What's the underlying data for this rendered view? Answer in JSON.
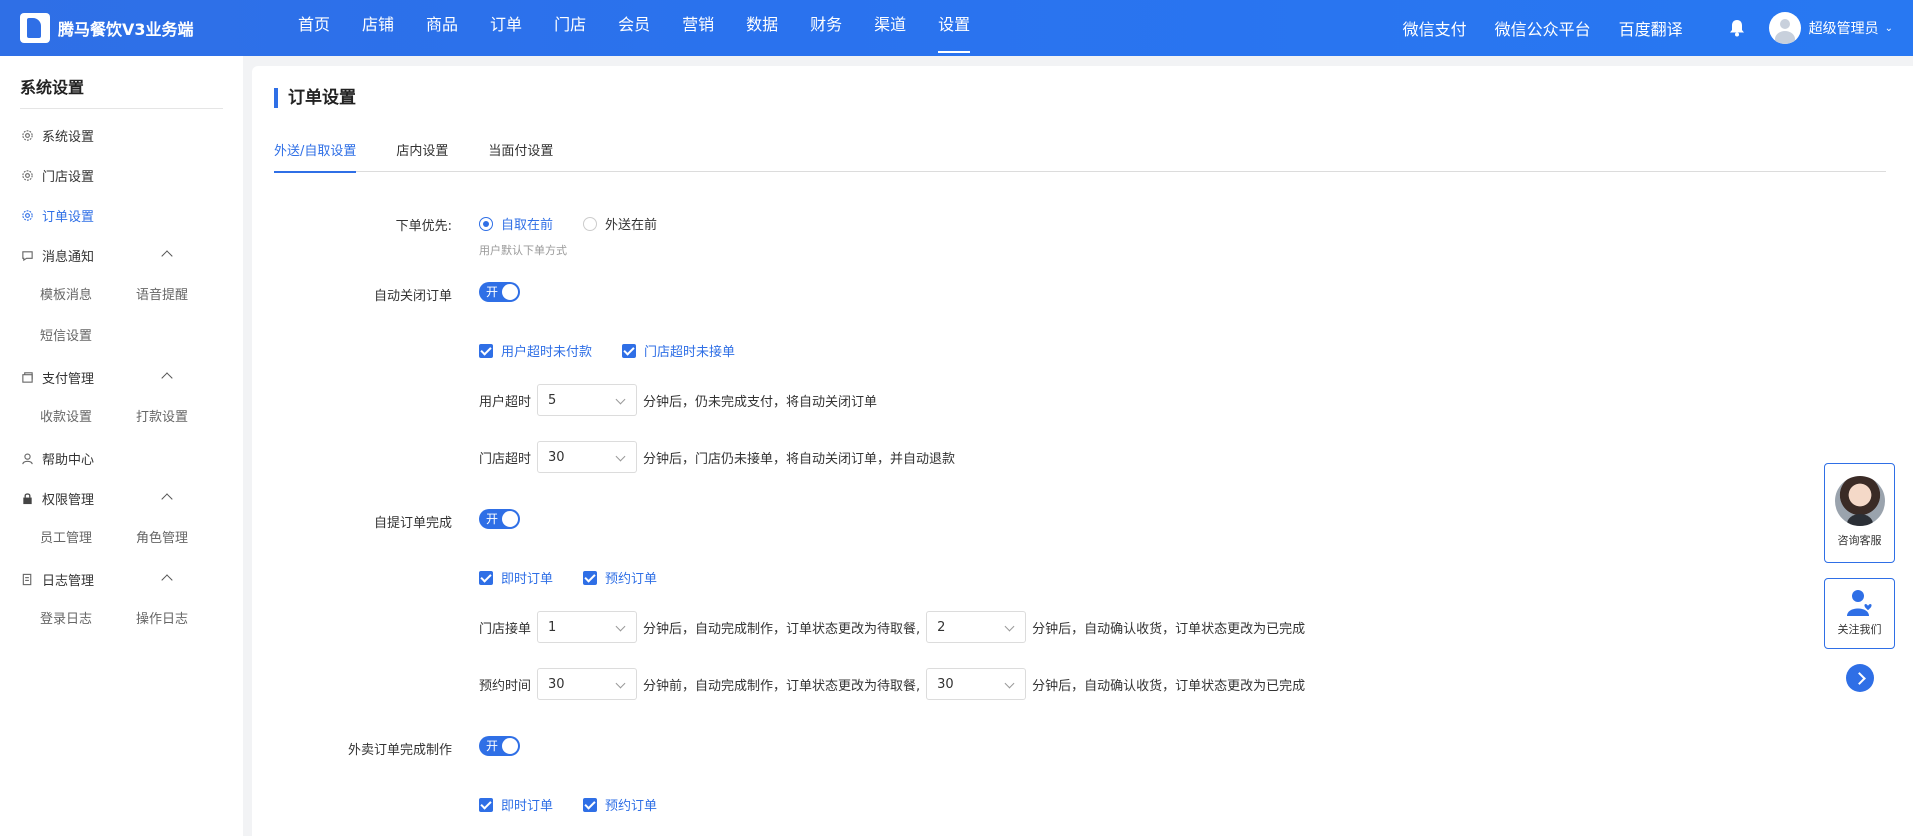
{
  "app": {
    "title": "腾马餐饮V3业务端"
  },
  "nav": {
    "items": [
      "首页",
      "店铺",
      "商品",
      "订单",
      "门店",
      "会员",
      "营销",
      "数据",
      "财务",
      "渠道",
      "设置"
    ],
    "active": "设置",
    "right_links": [
      "微信支付",
      "微信公众平台",
      "百度翻译"
    ],
    "user": "超级管理员"
  },
  "sidebar": {
    "title": "系统设置",
    "items": [
      {
        "label": "系统设置",
        "icon": "gear-icon"
      },
      {
        "label": "门店设置",
        "icon": "gear-icon"
      },
      {
        "label": "订单设置",
        "icon": "gear-icon",
        "active": true
      },
      {
        "label": "消息通知",
        "icon": "chat-icon",
        "sub": [
          "模板消息",
          "语音提醒",
          "短信设置"
        ]
      },
      {
        "label": "支付管理",
        "icon": "wallet-icon",
        "sub": [
          "收款设置",
          "打款设置"
        ]
      },
      {
        "label": "帮助中心",
        "icon": "user-icon"
      },
      {
        "label": "权限管理",
        "icon": "lock-icon",
        "sub": [
          "员工管理",
          "角色管理"
        ]
      },
      {
        "label": "日志管理",
        "icon": "log-icon",
        "sub": [
          "登录日志",
          "操作日志"
        ]
      }
    ]
  },
  "page": {
    "title": "订单设置",
    "tabs": [
      "外送/自取设置",
      "店内设置",
      "当面付设置"
    ],
    "active_tab": "外送/自取设置"
  },
  "form": {
    "order_priority": {
      "label": "下单优先:",
      "options": [
        "自取在前",
        "外送在前"
      ],
      "selected": "自取在前",
      "hint": "用户默认下单方式"
    },
    "auto_close": {
      "label": "自动关闭订单",
      "switch_text": "开",
      "checks": [
        "用户超时未付款",
        "门店超时未接单"
      ],
      "user_timeout_label": "用户超时",
      "user_timeout_value": "5",
      "user_timeout_suffix": "分钟后，仍未完成支付，将自动关闭订单",
      "store_timeout_label": "门店超时",
      "store_timeout_value": "30",
      "store_timeout_suffix": "分钟后，门店仍未接单，将自动关闭订单，并自动退款"
    },
    "pickup_complete": {
      "label": "自提订单完成",
      "switch_text": "开",
      "checks": [
        "即时订单",
        "预约订单"
      ],
      "accept_label": "门店接单",
      "accept_value_1": "1",
      "accept_mid": "分钟后，自动完成制作，订单状态更改为待取餐,",
      "accept_value_2": "2",
      "accept_suffix": "分钟后，自动确认收货，订单状态更改为已完成",
      "reserve_label": "预约时间",
      "reserve_value_1": "30",
      "reserve_mid": "分钟前，自动完成制作，订单状态更改为待取餐,",
      "reserve_value_2": "30",
      "reserve_suffix": "分钟后，自动确认收货，订单状态更改为已完成"
    },
    "delivery_complete": {
      "label": "外卖订单完成制作",
      "switch_text": "开",
      "checks": [
        "即时订单",
        "预约订单"
      ]
    }
  },
  "float": {
    "consult": "咨询客服",
    "follow": "关注我们"
  },
  "colors": {
    "primary": "#2f6fe6"
  }
}
